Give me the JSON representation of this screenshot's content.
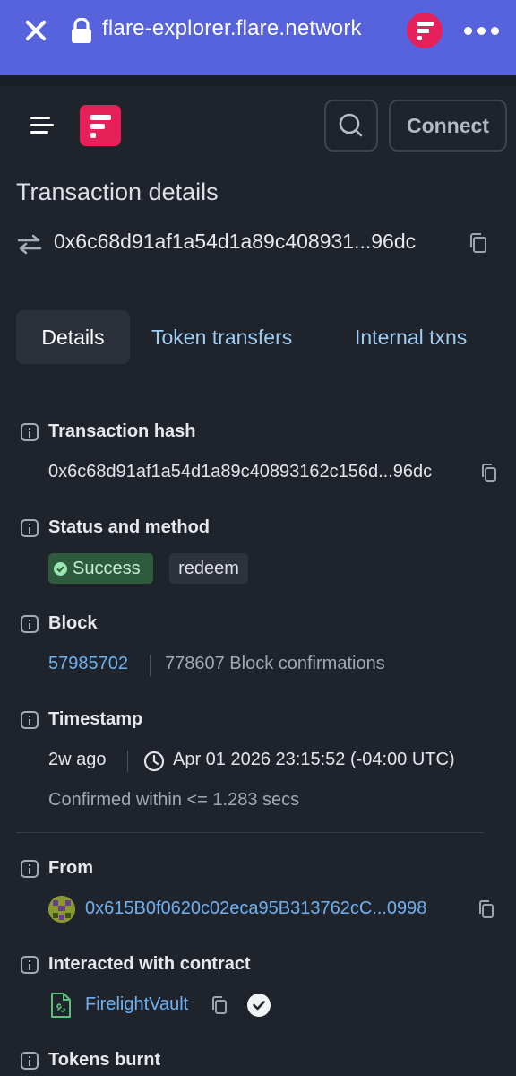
{
  "browser": {
    "url": "flare-explorer.flare.network",
    "close_icon": "close-icon",
    "lock_icon": "lock-icon",
    "more_icon": "more-dots-icon",
    "bar_color": "#5663dc"
  },
  "header": {
    "connect_label": "Connect",
    "brand_color": "#e62058"
  },
  "page": {
    "title": "Transaction details",
    "hash_short": "0x6c68d91af1a54d1a89c408931...96dc"
  },
  "tabs": [
    {
      "label": "Details",
      "active": true
    },
    {
      "label": "Token transfers",
      "active": false
    },
    {
      "label": "Internal txns",
      "active": false
    }
  ],
  "details": {
    "tx_hash": {
      "label": "Transaction hash",
      "value": "0x6c68d91af1a54d1a89c40893162c156d...96dc"
    },
    "status": {
      "label": "Status and method",
      "status": "Success",
      "method": "redeem"
    },
    "block": {
      "label": "Block",
      "number": "57985702",
      "confirmations": "778607 Block confirmations"
    },
    "timestamp": {
      "label": "Timestamp",
      "relative": "2w ago",
      "absolute": "Apr 01 2026 23:15:52 (-04:00 UTC)",
      "confirmed": "Confirmed within <= 1.283 secs"
    },
    "from": {
      "label": "From",
      "address": "0x615B0f0620c02eca95B313762cC...0998"
    },
    "contract": {
      "label": "Interacted with contract",
      "name": "FirelightVault"
    },
    "tokens_burnt": {
      "label": "Tokens burnt"
    }
  },
  "colors": {
    "background": "#1f232c",
    "link": "#6fb1ef",
    "tab_link": "#9fcdf2",
    "success_bg": "#2e5a3d"
  }
}
